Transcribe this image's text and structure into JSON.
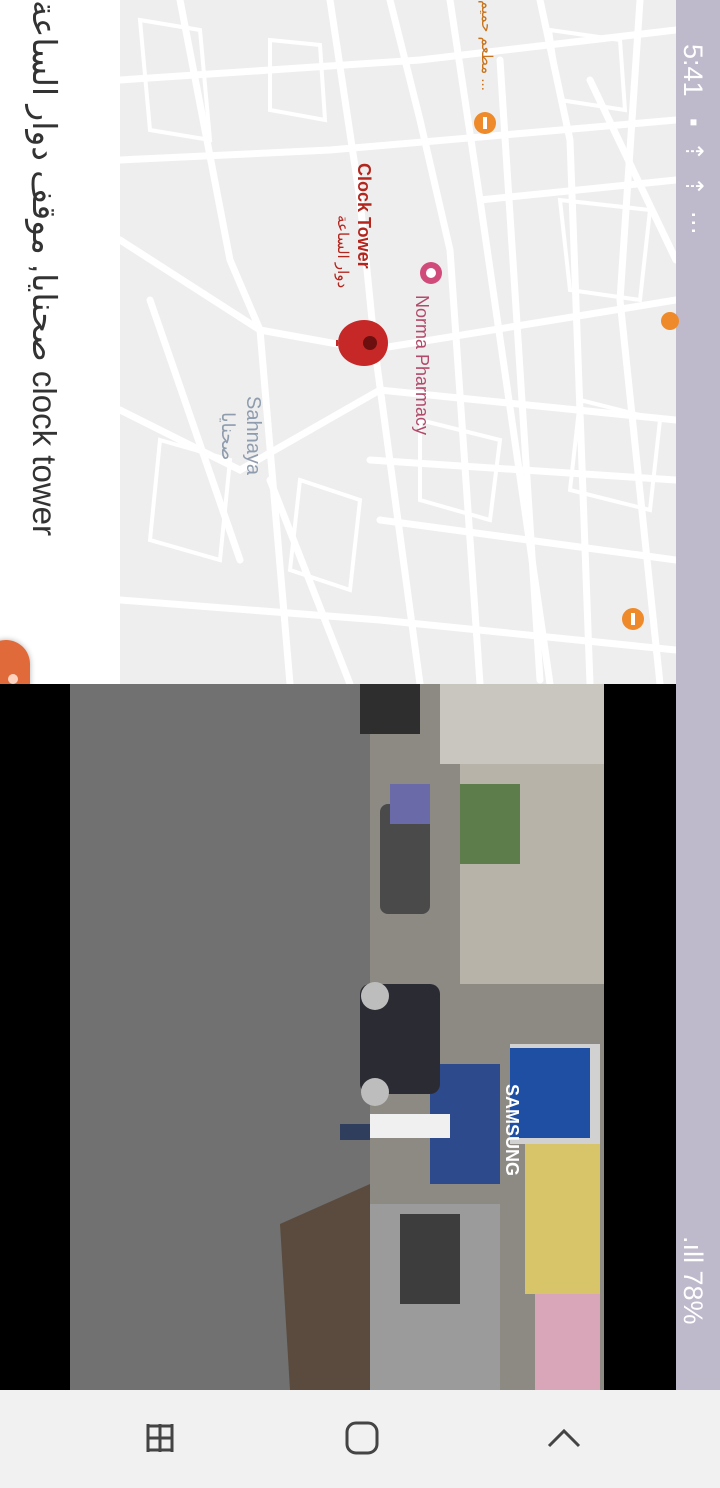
{
  "status_bar": {
    "time": "5:41",
    "icons_text": "▪ ⇡ ⇡ ⋯",
    "battery": ".ıll 78%"
  },
  "map": {
    "clock_tower_label": "Clock Tower",
    "clock_tower_label_ar": "دوار الساعة",
    "pharmacy_label": "Norma Pharmacy",
    "area_label": "Sahnaya",
    "area_label_ar": "صحنايا",
    "restaurant_label": "مطعم حميم ..."
  },
  "place": {
    "title": "صحنايا, موقف دوار الساعة clock tower"
  },
  "photo": {
    "shop_sign": "SAMSUNG"
  },
  "nav": {
    "recents_icon": "recent-apps-icon",
    "home_icon": "home-icon",
    "back_icon": "back-icon"
  },
  "colors": {
    "status_bar": "#bfb9cc",
    "map_bg": "#eeeeee",
    "pin": "#c62828",
    "poi_orange": "#ef8a2a",
    "fab": "#e06a39"
  }
}
